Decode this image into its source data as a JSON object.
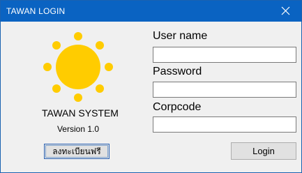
{
  "window": {
    "title": "TAWAN LOGIN",
    "close_glyph": "close-icon"
  },
  "branding": {
    "logo_icon": "sun-icon",
    "logo_color": "#ffcc00",
    "app_name": "TAWAN SYSTEM",
    "version": "Version 1.0"
  },
  "form": {
    "username_label": "User name",
    "username_value": "",
    "password_label": "Password",
    "password_value": "",
    "corpcode_label": "Corpcode",
    "corpcode_value": ""
  },
  "actions": {
    "register_label": "ลงทะเบียนฟรี",
    "login_label": "Login"
  },
  "colors": {
    "titlebar": "#0a63c2",
    "window_bg": "#f0f0f0"
  }
}
